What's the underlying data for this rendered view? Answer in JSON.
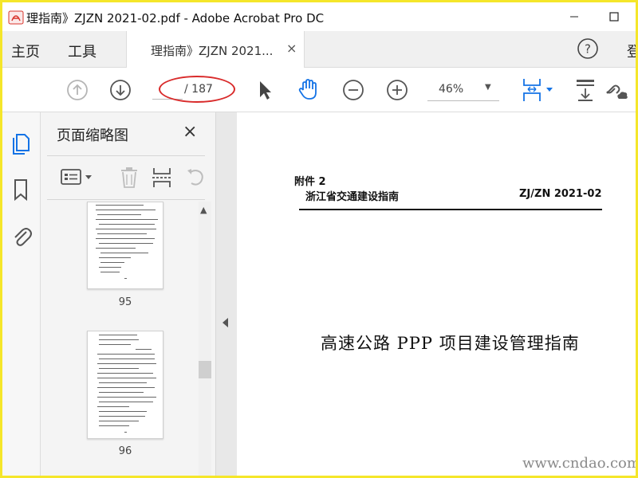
{
  "window": {
    "title": "理指南》ZJZN 2021-02.pdf - Adobe Acrobat Pro DC",
    "minimize_label": "—",
    "maximize_label": "☐"
  },
  "menu": {
    "home": "主页",
    "tools": "工具",
    "login_partial": "登"
  },
  "tab": {
    "label": "理指南》ZJZN 2021...",
    "close": "×"
  },
  "toolbar": {
    "page_current": "",
    "page_total": "/ 187",
    "zoom": "46%",
    "zoom_caret": "▼"
  },
  "panel": {
    "title": "页面缩略图",
    "close": "×",
    "thumbnails": [
      {
        "label": "95"
      },
      {
        "label": "96"
      }
    ]
  },
  "document": {
    "attachment_label": "附件 2",
    "header_left": "浙江省交通建设指南",
    "header_right": "ZJ/ZN 2021-02",
    "title": "高速公路 PPP 项目建设管理指南"
  },
  "watermark": "www.cndao.com",
  "colors": {
    "accent_blue": "#1473e6",
    "icon_gray": "#6e6e6e",
    "annotation_red": "#d92b2b",
    "outer_border": "#f5e62a"
  }
}
